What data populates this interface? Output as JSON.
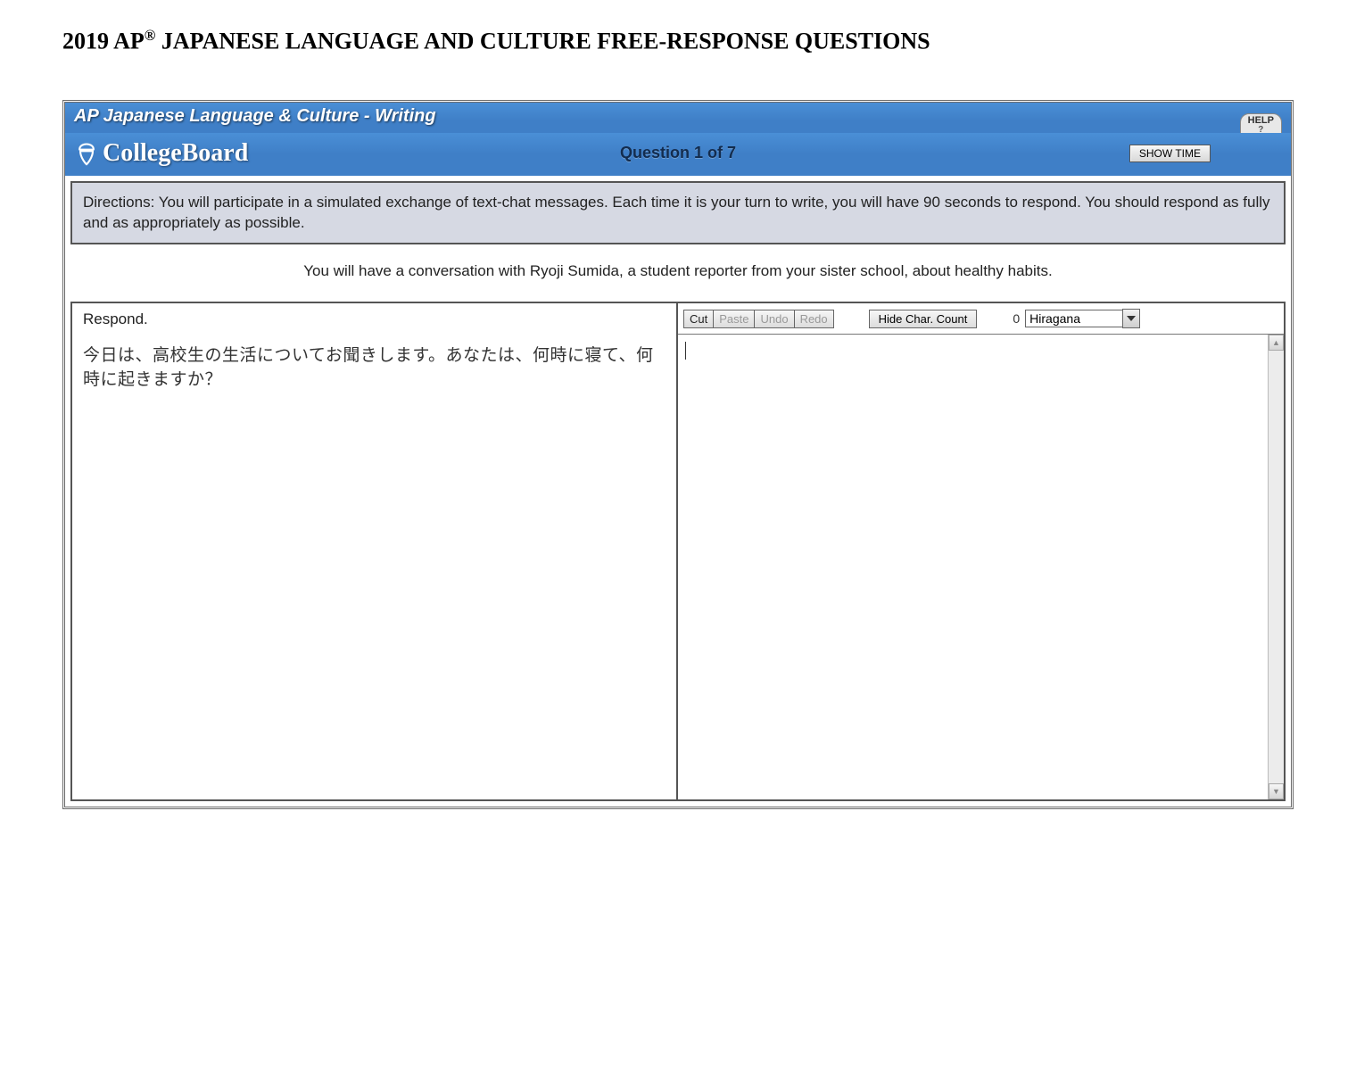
{
  "doc": {
    "title_prefix": "2019 AP",
    "title_reg": "®",
    "title_suffix": " JAPANESE LANGUAGE AND CULTURE FREE-RESPONSE QUESTIONS"
  },
  "titlebar": {
    "text": "AP Japanese Language & Culture  -  Writing",
    "help_label": "HELP",
    "help_icon": "?"
  },
  "brandbar": {
    "logo_text": "CollegeBoard",
    "question_label": "Question 1 of 7",
    "showtime_label": "SHOW TIME"
  },
  "directions": "Directions: You will participate in a simulated exchange of text-chat messages. Each time it is your turn to write, you will have 90 seconds to respond. You should respond as fully and as appropriately as possible.",
  "context": "You will have a conversation with Ryoji Sumida, a student reporter from your sister school, about healthy habits.",
  "left": {
    "respond_label": "Respond.",
    "jp_prompt": "今日は、高校生の生活についてお聞きします。あなたは、何時に寝て、何時に起きますか？"
  },
  "toolbar": {
    "cut": "Cut",
    "paste": "Paste",
    "undo": "Undo",
    "redo": "Redo",
    "hide_char": "Hide Char. Count",
    "ime_count": "0",
    "ime_mode": "Hiragana"
  }
}
